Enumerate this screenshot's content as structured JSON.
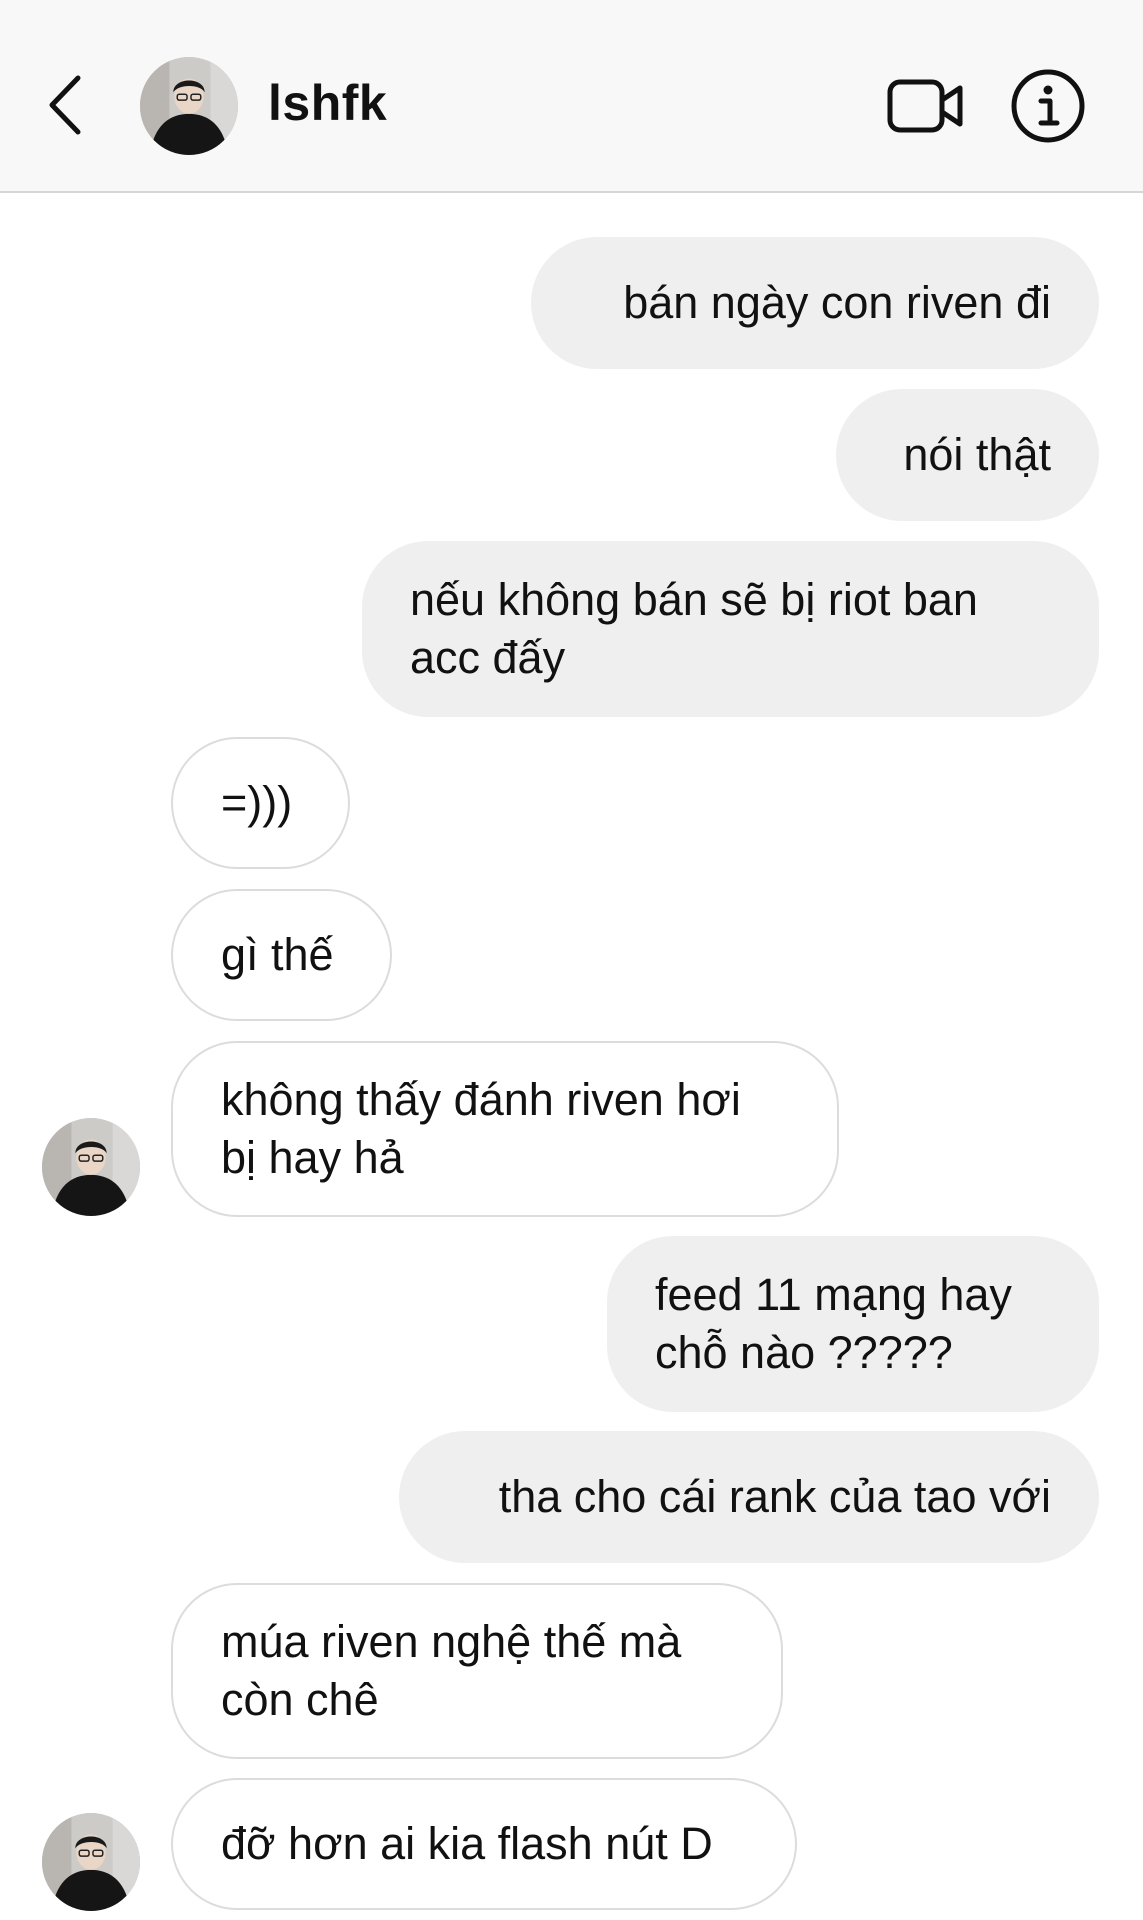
{
  "header": {
    "contact_name": "lshfk",
    "back_icon": "chevron-left-icon",
    "video_icon": "video-camera-icon",
    "info_icon": "info-icon"
  },
  "messages": [
    {
      "from": "me",
      "text": "bán ngày con riven đi"
    },
    {
      "from": "me",
      "text": "nói thật"
    },
    {
      "from": "me",
      "text": "nếu không bán sẽ bị riot ban\nacc đấy"
    },
    {
      "from": "them",
      "text": "=)))"
    },
    {
      "from": "them",
      "text": "gì thế"
    },
    {
      "from": "them",
      "text": "không thấy đánh riven hơi\nbị hay hả"
    },
    {
      "from": "me",
      "text": "feed 11 mạng hay\nchỗ nào ?????"
    },
    {
      "from": "me",
      "text": "tha cho cái rank của tao với"
    },
    {
      "from": "them",
      "text": "múa riven nghệ thế mà\ncòn chê"
    },
    {
      "from": "them",
      "text": "đỡ hơn ai kia flash nút D"
    }
  ],
  "colors": {
    "header_bg": "#f8f8f8",
    "sent_bubble": "#efefef",
    "received_border": "#dcdcdc",
    "text": "#111111"
  }
}
